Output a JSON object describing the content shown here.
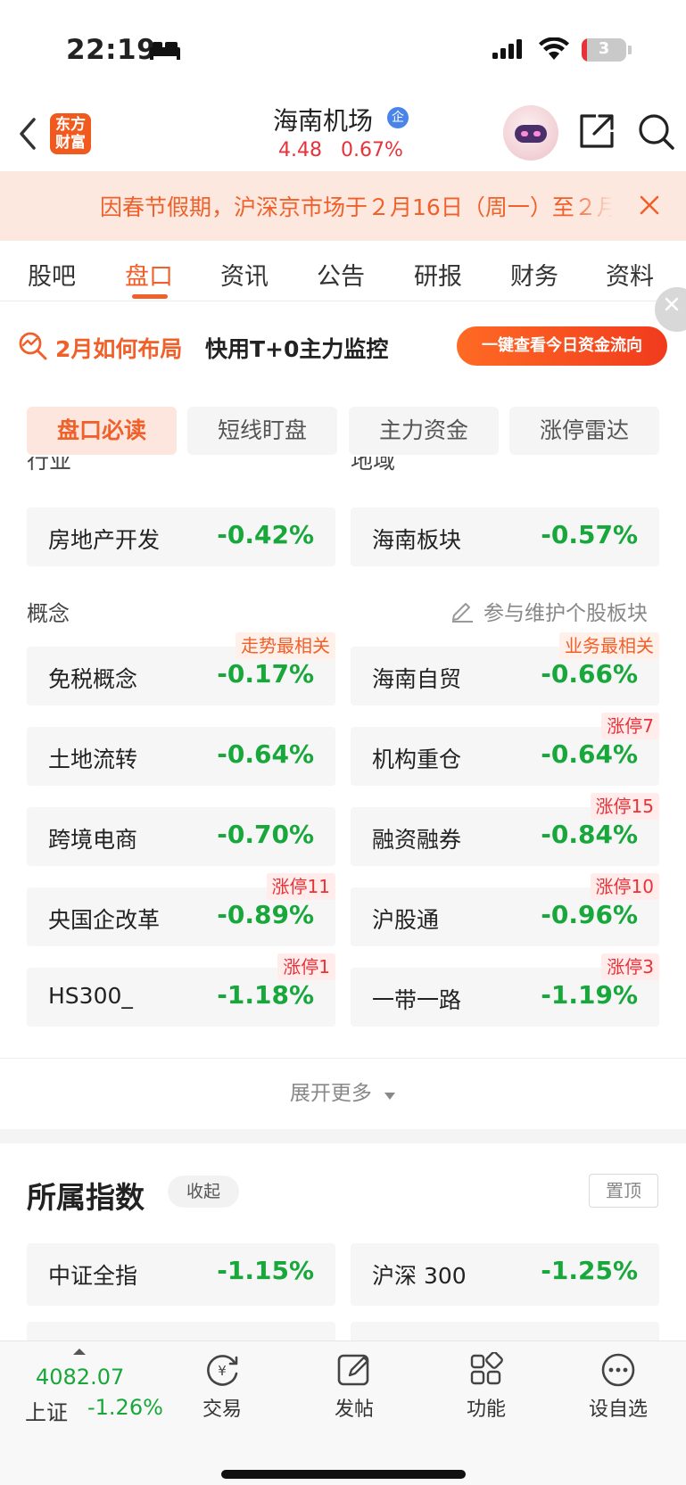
{
  "status_bar": {
    "time": "22:19",
    "battery": "3",
    "icons": [
      "bed-icon",
      "signal-icon",
      "wifi-icon",
      "battery-icon"
    ]
  },
  "header": {
    "logo_line1": "东方",
    "logo_line2": "财富",
    "stock_name": "海南机场",
    "badge": "企",
    "price": "4.48",
    "change_pct": "0.67%",
    "icons": [
      "back-icon",
      "robot-avatar-icon",
      "share-icon",
      "search-icon"
    ]
  },
  "notice": {
    "text": "因春节假期，沪深京市场于２月16日（周一）至２月"
  },
  "tabs": [
    {
      "label": "股吧"
    },
    {
      "label": "盘口"
    },
    {
      "label": "资讯"
    },
    {
      "label": "公告"
    },
    {
      "label": "研报"
    },
    {
      "label": "财务"
    },
    {
      "label": "资料"
    }
  ],
  "active_tab": "盘口",
  "promo": {
    "title": "2月如何布局",
    "subtitle": "快用T+0主力监控",
    "button": "一键查看今日资金流向"
  },
  "subtabs": [
    {
      "label": "盘口必读"
    },
    {
      "label": "短线盯盘"
    },
    {
      "label": "主力资金"
    },
    {
      "label": "涨停雷达"
    }
  ],
  "sections": {
    "industry_label": "行业",
    "region_label": "地域",
    "industry": {
      "name": "房地产开发",
      "pct": "-0.42%"
    },
    "region": {
      "name": "海南板块",
      "pct": "-0.57%"
    },
    "concept_label": "概念",
    "maintain_link": "参与维护个股板块",
    "concepts": [
      {
        "name": "免税概念",
        "pct": "-0.17%",
        "tag": "走势最相关"
      },
      {
        "name": "海南自贸",
        "pct": "-0.66%",
        "tag": "业务最相关"
      },
      {
        "name": "土地流转",
        "pct": "-0.64%",
        "tag": ""
      },
      {
        "name": "机构重仓",
        "pct": "-0.64%",
        "tag": "涨停7"
      },
      {
        "name": "跨境电商",
        "pct": "-0.70%",
        "tag": ""
      },
      {
        "name": "融资融券",
        "pct": "-0.84%",
        "tag": "涨停15"
      },
      {
        "name": "央国企改革",
        "pct": "-0.89%",
        "tag": "涨停11"
      },
      {
        "name": "沪股通",
        "pct": "-0.96%",
        "tag": "涨停10"
      },
      {
        "name": "HS300_",
        "pct": "-1.18%",
        "tag": "涨停1"
      },
      {
        "name": "一带一路",
        "pct": "-1.19%",
        "tag": "涨停3"
      }
    ],
    "expand_more": "展开更多"
  },
  "index_section": {
    "title": "所属指数",
    "collapse": "收起",
    "pin": "置顶",
    "items": [
      {
        "name": "中证全指",
        "pct": "-1.15%"
      },
      {
        "name": "沪深 300",
        "pct": "-1.25%"
      }
    ]
  },
  "bottom_bar": {
    "index_value": "4082.07",
    "index_name": "上证",
    "index_pct": "-1.26%",
    "nav": [
      {
        "label": "交易",
        "icon": "trade-icon"
      },
      {
        "label": "发帖",
        "icon": "post-icon"
      },
      {
        "label": "功能",
        "icon": "functions-icon"
      },
      {
        "label": "设自选",
        "icon": "add-watchlist-icon"
      }
    ]
  },
  "colors": {
    "accent": "#f0602a",
    "up": "#e8323a",
    "down": "#18a73a"
  }
}
